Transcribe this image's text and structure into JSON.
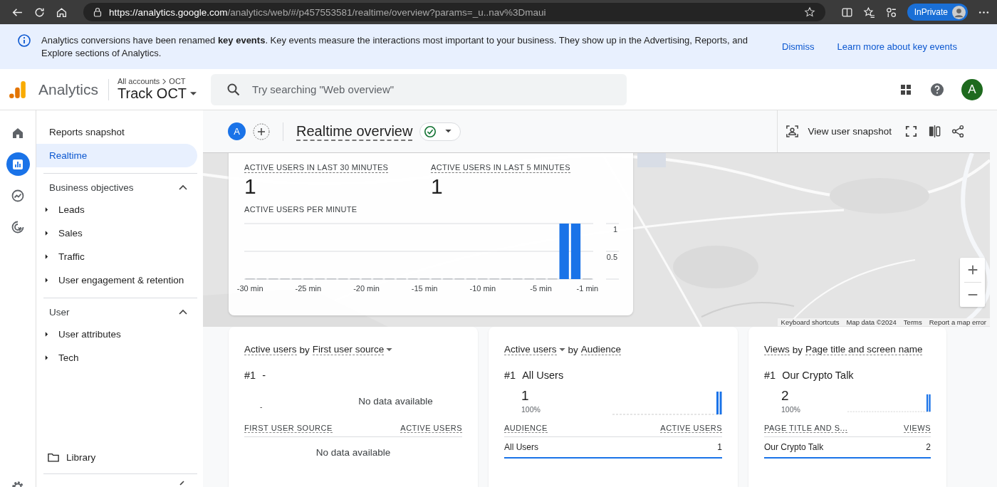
{
  "browser": {
    "url_host": "https://analytics.google.com",
    "url_path": "/analytics/web/#/p457553581/realtime/overview?params=_u..nav%3Dmaui",
    "profile_label": "InPrivate"
  },
  "banner": {
    "text": "Analytics conversions have been renamed **key events**. Key events measure the interactions most important to your business. They show up in the Advertising, Reports, and Explore sections of Analytics.",
    "actions": [
      "Dismiss",
      "Learn more about key events"
    ]
  },
  "header": {
    "product": "Analytics",
    "breadcrumb": "All accounts",
    "breadcrumb_child": "OCT",
    "property": "Track OCT",
    "search_placeholder": "Try searching \"Web overview\"",
    "avatar": "A"
  },
  "rail": [
    {
      "kind": "home",
      "selected": false
    },
    {
      "kind": "reports",
      "selected": true
    },
    {
      "kind": "explore",
      "selected": false
    },
    {
      "kind": "advertising",
      "selected": false
    }
  ],
  "sidebar": {
    "items": [
      {
        "label": "Reports snapshot",
        "selected": false
      },
      {
        "label": "Realtime",
        "selected": true
      }
    ],
    "sections": [
      {
        "title": "Business objectives",
        "expanded": true,
        "items": [
          {
            "label": "Leads",
            "expanded": false
          },
          {
            "label": "Sales",
            "expanded": false
          },
          {
            "label": "Traffic",
            "expanded": false
          },
          {
            "label": "User engagement & retention",
            "expanded": false
          }
        ]
      },
      {
        "title": "User",
        "expanded": true,
        "items": [
          {
            "label": "User attributes",
            "expanded": false
          },
          {
            "label": "Tech",
            "expanded": false
          }
        ]
      }
    ],
    "library": "Library"
  },
  "toolbar": {
    "comparison_avatar": "A",
    "title": "Realtime overview",
    "snapshot_action": "View user snapshot"
  },
  "summary_card": {
    "metrics": [
      {
        "label": "ACTIVE USERS IN LAST 30 MINUTES",
        "value": "1"
      },
      {
        "label": "ACTIVE USERS IN LAST 5 MINUTES",
        "value": "1"
      }
    ],
    "chart_title": "ACTIVE USERS PER MINUTE",
    "chart_data": {
      "type": "bar",
      "x": [
        -30,
        -29,
        -28,
        -27,
        -26,
        -25,
        -24,
        -23,
        -22,
        -21,
        -20,
        -19,
        -18,
        -17,
        -16,
        -15,
        -14,
        -13,
        -12,
        -11,
        -10,
        -9,
        -8,
        -7,
        -6,
        -5,
        -4,
        -3,
        -2,
        -1
      ],
      "values": [
        0,
        0,
        0,
        0,
        0,
        0,
        0,
        0,
        0,
        0,
        0,
        0,
        0,
        0,
        0,
        0,
        0,
        0,
        0,
        0,
        0,
        0,
        0,
        0,
        0,
        0,
        0,
        1,
        1,
        0
      ],
      "xlim": [
        -30.5,
        -0.5
      ],
      "ylim": [
        0,
        1
      ],
      "yticks": [
        0.5,
        1
      ],
      "xticks": [
        {
          "value": -30,
          "label": "-30 min"
        },
        {
          "value": -25,
          "label": "-25 min"
        },
        {
          "value": -20,
          "label": "-20 min"
        },
        {
          "value": -15,
          "label": "-15 min"
        },
        {
          "value": -10,
          "label": "-10 min"
        },
        {
          "value": -5,
          "label": "-5 min"
        },
        {
          "value": -1,
          "label": "-1 min"
        }
      ]
    }
  },
  "map": {
    "kind": "picture",
    "attribution": [
      "Keyboard shortcuts",
      "Map data ©2024",
      "Terms",
      "Report a map error"
    ]
  },
  "cards": [
    {
      "kind": "empty",
      "metric": "Active users",
      "connector": "by",
      "dimension": "First user source",
      "metric_dropdown": false,
      "dimension_dropdown": true,
      "rank": "#1",
      "top_name": "-",
      "top_value": "-",
      "no_data": "No data available",
      "columns": [
        "FIRST USER SOURCE",
        "ACTIVE USERS"
      ],
      "empty_text": "No data available"
    },
    {
      "kind": "data",
      "metric": "Active users",
      "connector": "by",
      "dimension": "Audience",
      "metric_dropdown": true,
      "dimension_dropdown": false,
      "rank": "#1",
      "top_name": "All Users",
      "top_value": "1",
      "top_share": "100%",
      "columns": [
        "AUDIENCE",
        "ACTIVE USERS"
      ],
      "rows": [
        {
          "name": "All Users",
          "value": "1",
          "level": 1
        }
      ]
    },
    {
      "kind": "data",
      "metric": "Views",
      "connector": "by",
      "dimension": "Page title and screen name",
      "metric_dropdown": false,
      "dimension_dropdown": false,
      "rank": "#1",
      "top_name": "Our Crypto Talk",
      "top_value": "2",
      "top_share": "100%",
      "columns": [
        "PAGE TITLE AND S...",
        "VIEWS"
      ],
      "rows": [
        {
          "name": "Our Crypto Talk",
          "value": "2",
          "level": 1
        }
      ]
    }
  ]
}
